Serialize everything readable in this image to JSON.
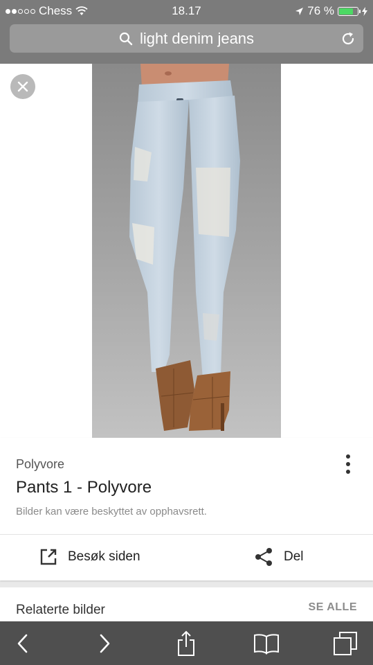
{
  "status_bar": {
    "carrier": "Chess",
    "time": "18.17",
    "battery_percent": "76 %",
    "battery_level": 0.76
  },
  "address_bar": {
    "query": "light denim jeans"
  },
  "image": {
    "description_icon": "light-distressed-skinny-jeans-photo"
  },
  "result": {
    "source": "Polyvore",
    "title": "Pants 1 - Polyvore",
    "copyright_note": "Bilder kan være beskyttet av opphavsrett.",
    "visit_label": "Besøk siden",
    "share_label": "Del"
  },
  "related": {
    "heading": "Relaterte bilder",
    "see_all": "SE ALLE"
  },
  "colors": {
    "topbar": "#7b7b7b",
    "toolbar": "#4f4f4f",
    "battery": "#4cd964"
  }
}
